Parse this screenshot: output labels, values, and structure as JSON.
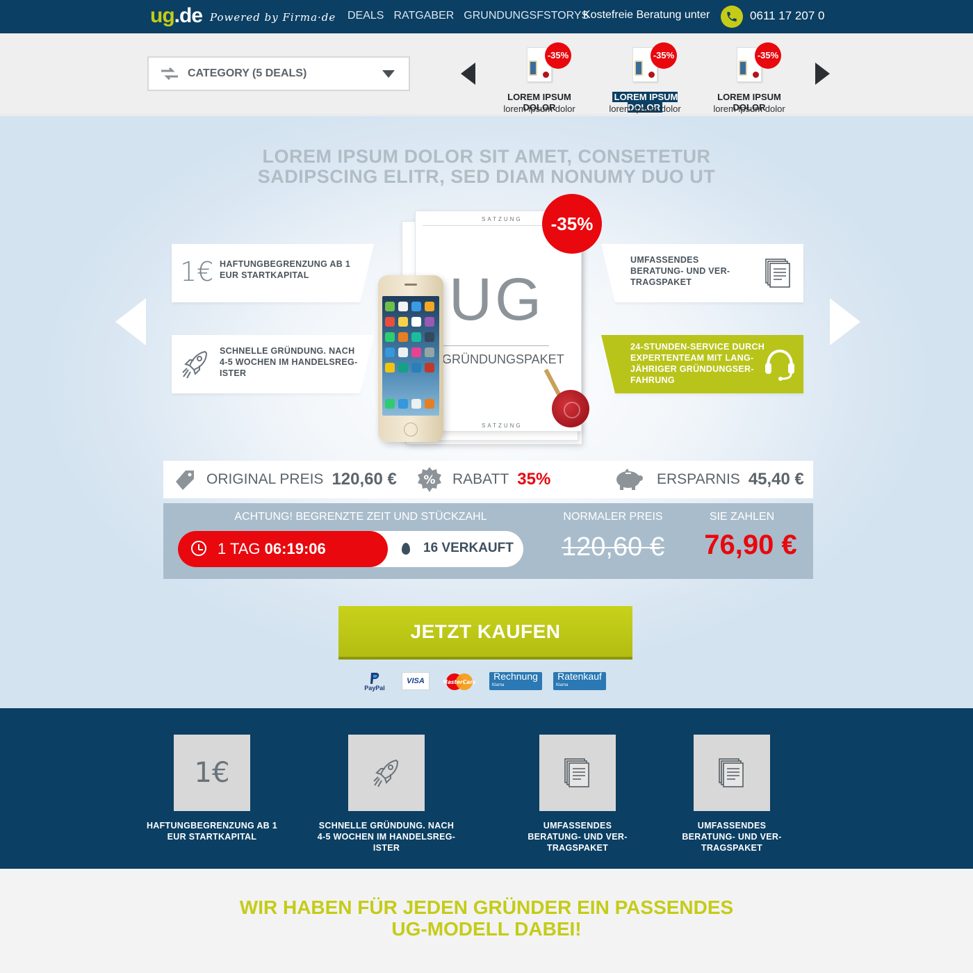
{
  "header": {
    "logo_ug": "ug",
    "logo_de": ".de",
    "powered": "Powered by Firma·de",
    "nav": [
      "DEALS",
      "RATGABER",
      "GRUNDUNGSFSTORYS"
    ],
    "phone_label": "Kostefreie Beratung unter",
    "phone_number": "0611 17 207 0"
  },
  "deals_bar": {
    "category_label": "CATEGORY (5 DEALS)",
    "deals": [
      {
        "badge": "-35%",
        "title": "LOREM IPSUM DOLOR",
        "subtitle": "lorem ipsum dolor",
        "active": false
      },
      {
        "badge": "-35%",
        "title": "LOREM IPSUM DOLOR",
        "subtitle": "lorem ipsum dolor",
        "active": true
      },
      {
        "badge": "-35%",
        "title": "LOREM IPSUM DOLOR",
        "subtitle": "lorem ipsum dolor",
        "active": false
      }
    ]
  },
  "hero": {
    "title_line1": "LOREM IPSUM DOLOR SIT AMET, CONSETETUR",
    "title_line2": "SADIPSCING ELITR, SED DIAM NONUMY DUO UT",
    "badge": "-35%",
    "product": {
      "big_text": "UG",
      "name": "GRÜNDUNGSPAKET",
      "satzung": "SATZUNG"
    },
    "features": {
      "f1_icon_text": "1€",
      "f1_line1": "HAFTUNGBEGRENZUNG AB 1",
      "f1_line2": "EUR STARTKAPITAL",
      "f2_line1": "SCHNELLE GRÜNDUNG. NACH",
      "f2_line2": "4-5 WOCHEN IM HANDELSREG-",
      "f2_line3": "ISTER",
      "f3_line1": "UMFASSENDES",
      "f3_line2": "BERATUNG- UND VER-",
      "f3_line3": "TRAGSPAKET",
      "f4_line1": "24-STUNDEN-SERVICE DURCH",
      "f4_line2": "EXPERTENTEAM MIT LANG-",
      "f4_line3": "JÄHRIGER GRÜNDUNGSER-",
      "f4_line4": "FAHRUNG"
    }
  },
  "prices": {
    "original_label": "ORIGINAL PREIS",
    "original_value": "120,60 €",
    "discount_label": "RABATT",
    "discount_value": "35%",
    "savings_label": "ERSPARNIS",
    "savings_value": "45,40 €"
  },
  "countdown": {
    "attention": "ACHTUNG! BEGRENZTE ZEIT UND STÜCKZAHL",
    "days": "1 TAG",
    "time": "06:19:06",
    "sold": "16 VERKAUFT",
    "normal_label": "NORMALER PREIS",
    "normal_value": "120,60 €",
    "pay_label": "SIE ZAHLEN",
    "pay_value": "76,90 €"
  },
  "buy_button": "JETZT KAUFEN",
  "payments": {
    "paypal": "PayPal",
    "visa": "VISA",
    "mastercard": "MasterCard",
    "klarna_invoice": "Rechnung",
    "klarna_installment": "Ratenkauf",
    "klarna_small": "Klarna"
  },
  "band": {
    "items": [
      {
        "icon_text": "1€",
        "line1": "HAFTUNGBEGRENZUNG AB 1",
        "line2": "EUR STARTKAPITAL",
        "line3": ""
      },
      {
        "icon_text": "",
        "line1": "SCHNELLE GRÜNDUNG. NACH",
        "line2": "4-5 WOCHEN IM HANDELSREG-",
        "line3": "ISTER"
      },
      {
        "icon_text": "",
        "line1": "UMFASSENDES",
        "line2": "BERATUNG- UND VER-",
        "line3": "TRAGSPAKET"
      },
      {
        "icon_text": "",
        "line1": "UMFASSENDES",
        "line2": "BERATUNG- UND VER-",
        "line3": "TRAGSPAKET"
      }
    ]
  },
  "bottom": {
    "title_line1": "WIR HABEN FÜR JEDEN GRÜNDER EIN PASSENDES",
    "title_line2": "UG-MODELL DABEI!"
  },
  "colors": {
    "navy": "#0b3f63",
    "lime": "#c4cc17",
    "red": "#e8080d",
    "panel_blue": "#a9bccb"
  }
}
